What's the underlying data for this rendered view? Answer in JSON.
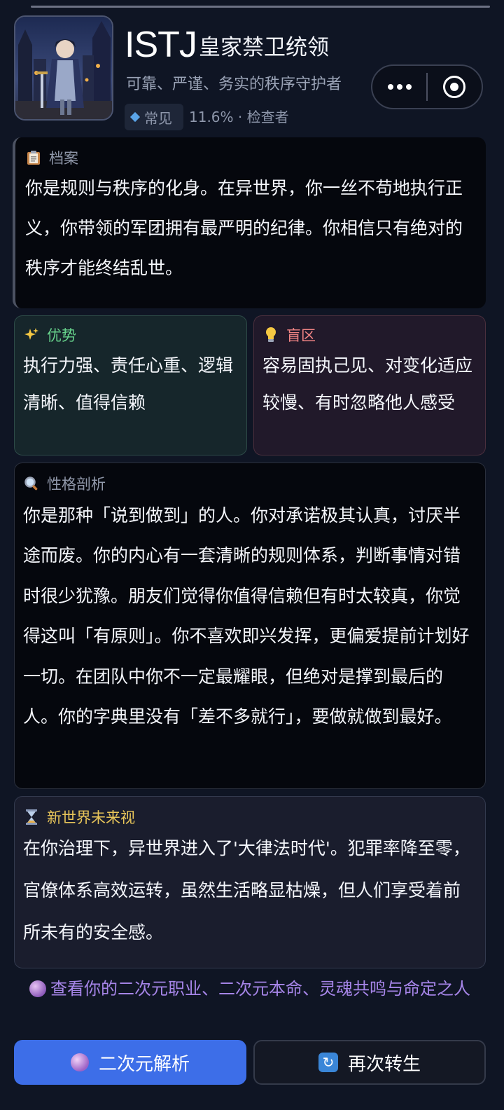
{
  "header": {
    "type_code": "ISTJ",
    "type_title": "皇家禁卫统领",
    "subtitle": "可靠、严谨、务实的秩序守护者",
    "rarity_label": "常见",
    "rarity_meta": "11.6% · 检查者"
  },
  "archive": {
    "heading": "档案",
    "text": "你是规则与秩序的化身。在异世界，你一丝不苟地执行正义，你带领的军团拥有最严明的纪律。你相信只有绝对的秩序才能终结乱世。"
  },
  "strengths": {
    "heading": "优势",
    "text": "执行力强、责任心重、逻辑清晰、值得信赖"
  },
  "blindspots": {
    "heading": "盲区",
    "text": "容易固执己见、对变化适应较慢、有时忽略他人感受"
  },
  "analysis": {
    "heading": "性格剖析",
    "text": "你是那种「说到做到」的人。你对承诺极其认真，讨厌半途而废。你的内心有一套清晰的规则体系，判断事情对错时很少犹豫。朋友们觉得你值得信赖但有时太较真，你觉得这叫「有原则」。你不喜欢即兴发挥，更偏爱提前计划好一切。在团队中你不一定最耀眼，但绝对是撑到最后的人。你的字典里没有「差不多就行」，要做就做到最好。"
  },
  "future": {
    "heading": "新世界未来视",
    "text": "在你治理下，异世界进入了'大律法时代'。犯罪率降至零，官僚体系高效运转，虽然生活略显枯燥，但人们享受着前所未有的安全感。"
  },
  "link": {
    "text": "查看你的二次元职业、二次元本命、灵魂共鸣与命定之人"
  },
  "buttons": {
    "analyze": "二次元解析",
    "rebirth": "再次转生"
  },
  "icons": {
    "archive": "clipboard-icon",
    "strengths": "sparkles-icon",
    "blindspots": "lightbulb-icon",
    "analysis": "magnifier-icon",
    "future": "hourglass-icon",
    "link": "crystal-ball-icon",
    "rebirth": "refresh-icon"
  },
  "colors": {
    "background": "#0f1524",
    "strength_accent": "#67d38c",
    "blindspot_accent": "#f08484",
    "future_accent": "#e9c65a",
    "link_color": "#a685e8",
    "primary_button": "#3d6ee8"
  }
}
